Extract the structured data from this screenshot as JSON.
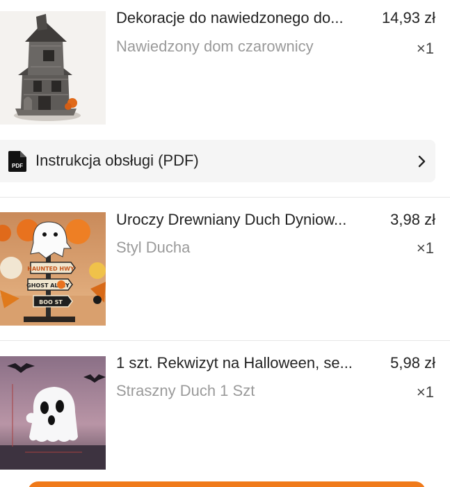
{
  "items": [
    {
      "title": "Dekoracje do nawiedzonego do...",
      "price": "14,93 zł",
      "variant": "Nawiedzony dom czarownicy",
      "quantity": "×1",
      "image": "haunted-house-figurine"
    },
    {
      "title": "Uroczy Drewniany Duch Dyniow...",
      "price": "3,98 zł",
      "variant": "Styl Ducha",
      "quantity": "×1",
      "image": "wooden-ghost-signpost",
      "image_texts": [
        "HAUNTED HWY",
        "GHOST ALLEY",
        "BOO ST"
      ]
    },
    {
      "title": "1 szt. Rekwizyt na Halloween, se...",
      "price": "5,98 zł",
      "variant": "Straszny Duch 1 Szt",
      "quantity": "×1",
      "image": "white-ghost-figurine"
    }
  ],
  "manual": {
    "label": "Instrukcja obsługi (PDF)",
    "icon": "pdf-file-icon",
    "pdf_badge": "PDF"
  },
  "colors": {
    "accent": "#f07a1a",
    "text": "#222222",
    "muted": "#9a9a9a",
    "row_bg": "#f5f5f5"
  }
}
